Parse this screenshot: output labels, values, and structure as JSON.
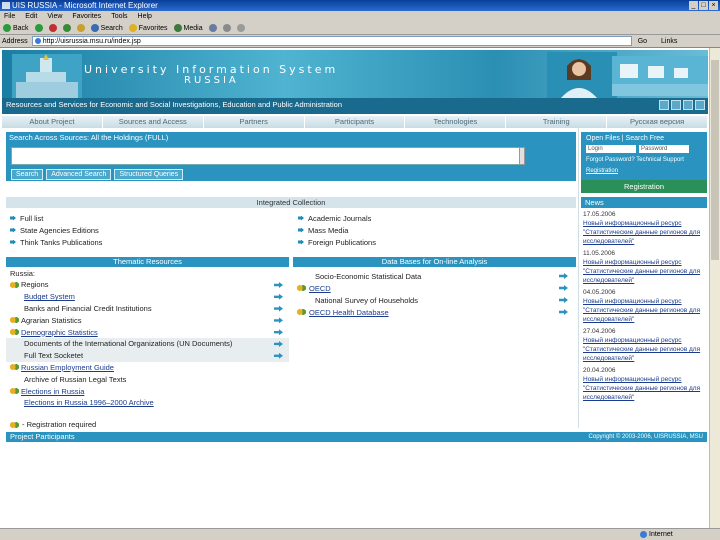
{
  "window": {
    "title": "UIS RUSSIA - Microsoft Internet Explorer"
  },
  "menu": [
    "File",
    "Edit",
    "View",
    "Favorites",
    "Tools",
    "Help"
  ],
  "toolbar": {
    "back": "Back",
    "search": "Search",
    "favorites": "Favorites",
    "media": "Media"
  },
  "address": {
    "label": "Address",
    "url": "http://uisrussia.msu.ru/index.jsp",
    "go": "Go",
    "links": "Links"
  },
  "banner": {
    "title": "University Information System",
    "subtitle": "RUSSIA",
    "tagline": "Resources and Services for Economic and Social Investigations, Education and Public Administration"
  },
  "nav": [
    "About Project",
    "Sources and Access",
    "Partners",
    "Participants",
    "Technologies",
    "Training",
    "Русская версия"
  ],
  "search": {
    "heading": "Search Across Sources: All the Holdings (FULL)",
    "buttons": [
      "Search",
      "Advanced Search",
      "Structured Queries"
    ]
  },
  "login": {
    "heading": "Open Files | Search Free",
    "login_ph": "Login",
    "password_ph": "Password",
    "text": "Forgot Password? Technical Support",
    "link": "Registration"
  },
  "registration": "Registration",
  "news": {
    "heading": "News",
    "items": [
      {
        "date": "17.05.2006",
        "text": "Новый информационный ресурс \"Статистические данные регионов для исследователей\""
      },
      {
        "date": "11.05.2006",
        "text": "Новый информационный ресурс \"Статистические данные регионов для исследователей\""
      },
      {
        "date": "04.05.2006",
        "text": "Новый информационный ресурс \"Статистические данные регионов для исследователей\""
      },
      {
        "date": "27.04.2006",
        "text": "Новый информационный ресурс \"Статистические данные регионов для исследователей\""
      },
      {
        "date": "20.04.2006",
        "text": "Новый информационный ресурс \"Статистические данные регионов для исследователей\""
      }
    ]
  },
  "collection": {
    "heading": "Integrated Collection",
    "left": [
      "Full list",
      "State Agencies Editions",
      "Think Tanks Publications"
    ],
    "right": [
      "Academic Journals",
      "Mass Media",
      "Foreign Publications"
    ]
  },
  "thematic": {
    "heading": "Thematic Resources",
    "group": "Russia:",
    "items": [
      {
        "label": "Regions",
        "reg": true
      },
      {
        "label": "Budget System",
        "reg": false,
        "link": true
      },
      {
        "label": "Banks and Financial Credit Institutions",
        "reg": false
      },
      {
        "label": "Agrarian Statistics",
        "reg": true
      },
      {
        "label": "Demographic Statistics",
        "reg": true,
        "link": true
      },
      {
        "label": "Documents of the International Organizations (UN Documents)",
        "reg": false
      },
      {
        "label": "Full Text Socketet",
        "reg": false
      },
      {
        "label": "Russian Employment Guide",
        "reg": true,
        "link": true
      },
      {
        "label": "Archive of Russian Legal Texts",
        "reg": false
      },
      {
        "label": "Elections in Russia",
        "reg": true,
        "link": true
      },
      {
        "label": "Elections in Russia 1996–2000 Archive",
        "reg": false,
        "link": true
      }
    ]
  },
  "databases": {
    "heading": "Data Bases for On-line Analysis",
    "items": [
      {
        "label": "Socio-Economic Statistical Data",
        "reg": false
      },
      {
        "label": "OECD",
        "reg": true,
        "link": true
      },
      {
        "label": "National Survey of Households",
        "reg": false
      },
      {
        "label": "OECD Health Database",
        "reg": true,
        "link": true
      }
    ]
  },
  "legend": "- Registration required",
  "footer": {
    "label": "Project Participants",
    "copy": "Copyright © 2003-2006, UISRUSSIA, MSU"
  },
  "status": {
    "zone": "Internet"
  }
}
